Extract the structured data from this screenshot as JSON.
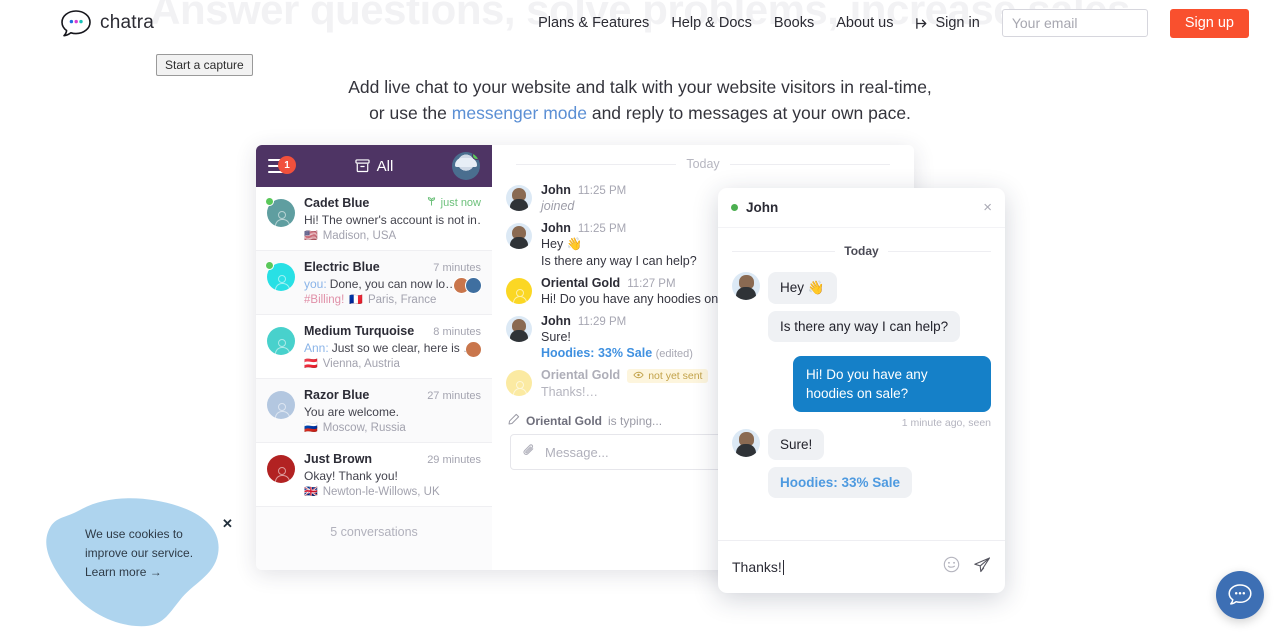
{
  "hero": {
    "background_headline": "Answer questions, solve problems, increase sales",
    "subtitle_line1": "Add live chat to your website and talk with your website visitors in real-time,",
    "subtitle_before_link": "or use the ",
    "subtitle_link": "messenger mode",
    "subtitle_after_link": " and reply to messages at your own pace."
  },
  "brand": {
    "name": "chatra"
  },
  "capture": {
    "label": "Start a capture"
  },
  "nav": {
    "links": [
      {
        "label": "Plans & Features"
      },
      {
        "label": "Help & Docs"
      },
      {
        "label": "Books"
      },
      {
        "label": "About us"
      }
    ],
    "signin_label": "Sign in",
    "email_placeholder": "Your email",
    "email_value": "",
    "signup_label": "Sign up",
    "signup_color": "#f9502e"
  },
  "app": {
    "header": {
      "badge_count": "1",
      "filter_label": "All",
      "header_bg": "#4e3464"
    },
    "conversations": [
      {
        "name": "Cadet Blue",
        "time": "just now",
        "time_style": "green",
        "preview_prefix": "",
        "preview": "Hi! The owner's account is not in…",
        "tag": "",
        "location": "Madison, USA",
        "flag": "🇺🇸",
        "avatar_color": "#5f9ea0",
        "online": true,
        "mini_avatars": []
      },
      {
        "name": "Electric Blue",
        "time": "7 minutes",
        "time_style": "grey",
        "preview_prefix": "you:",
        "preview": "Done, you can now lo…",
        "tag": "#Billing!",
        "location": "Paris, France",
        "flag": "🇫🇷",
        "avatar_color": "#28e0e5",
        "online": true,
        "mini_avatars": [
          "#c9764c",
          "#3f6fa0"
        ]
      },
      {
        "name": "Medium Turquoise",
        "time": "8 minutes",
        "time_style": "grey",
        "preview_prefix": "Ann:",
        "preview": "Just so we clear, here is …",
        "tag": "",
        "location": "Vienna, Austria",
        "flag": "🇦🇹",
        "avatar_color": "#48d1cc",
        "online": false,
        "mini_avatars": [
          "#c9764c"
        ]
      },
      {
        "name": "Razor Blue",
        "time": "27 minutes",
        "time_style": "grey",
        "preview_prefix": "",
        "preview": "You are welcome.",
        "tag": "",
        "location": "Moscow, Russia",
        "flag": "🇷🇺",
        "avatar_color": "#b3c7e0",
        "online": false,
        "mini_avatars": []
      },
      {
        "name": "Just Brown",
        "time": "29 minutes",
        "time_style": "grey",
        "preview_prefix": "",
        "preview": "Okay! Thank you!",
        "tag": "",
        "location": "Newton-le-Willows, UK",
        "flag": "🇬🇧",
        "avatar_color": "#b22222",
        "online": false,
        "mini_avatars": []
      }
    ],
    "conversations_footer": "5 conversations",
    "thread": {
      "divider": "Today",
      "messages": [
        {
          "who": "John",
          "time": "11:25 PM",
          "avatar": "john",
          "faded": false,
          "lines": [
            {
              "text": "joined",
              "style": "italic"
            }
          ]
        },
        {
          "who": "John",
          "time": "11:25 PM",
          "avatar": "john",
          "faded": false,
          "lines": [
            {
              "text": "Hey 👋",
              "style": "plain"
            },
            {
              "text": "Is there any way I can help?",
              "style": "plain"
            }
          ]
        },
        {
          "who": "Oriental Gold",
          "time": "11:27 PM",
          "avatar": "gold",
          "faded": false,
          "lines": [
            {
              "text": "Hi! Do you have any hoodies on",
              "style": "plain"
            }
          ]
        },
        {
          "who": "John",
          "time": "11:29 PM",
          "avatar": "john",
          "faded": false,
          "lines": [
            {
              "text": "Sure!",
              "style": "plain"
            },
            {
              "text": "Hoodies: 33% Sale",
              "style": "link",
              "suffix": "(edited)"
            }
          ]
        },
        {
          "who": "Oriental Gold",
          "time": "",
          "avatar": "gold-faded",
          "faded": true,
          "badge": "not yet sent",
          "lines": [
            {
              "text": "Thanks!…",
              "style": "faded"
            }
          ]
        }
      ],
      "typing_who": "Oriental Gold",
      "typing_suffix": "is typing...",
      "composer_placeholder": "Message..."
    }
  },
  "widget": {
    "agent_name": "John",
    "online": true,
    "close_label": "×",
    "divider": "Today",
    "messages": [
      {
        "side": "in",
        "text": "Hey 👋",
        "show_avatar": true,
        "link": false
      },
      {
        "side": "in",
        "text": "Is there any way I can help?",
        "show_avatar": false,
        "link": false
      },
      {
        "side": "out",
        "text": "Hi! Do you have any hoodies on sale?",
        "link": false
      },
      {
        "side": "meta",
        "text": "1 minute ago, seen"
      },
      {
        "side": "in",
        "text": "Sure!",
        "show_avatar": true,
        "link": false
      },
      {
        "side": "in",
        "text": "Hoodies: 33% Sale",
        "show_avatar": false,
        "link": true
      }
    ],
    "input_value": "Thanks!",
    "accent_out": "#1580c8"
  },
  "cookie": {
    "line1": "We use cookies to",
    "line2": "improve our service.",
    "link": "Learn more →",
    "close": "✕",
    "blob_color": "#aed4ee"
  },
  "launcher": {
    "color": "#3d6fb4"
  }
}
